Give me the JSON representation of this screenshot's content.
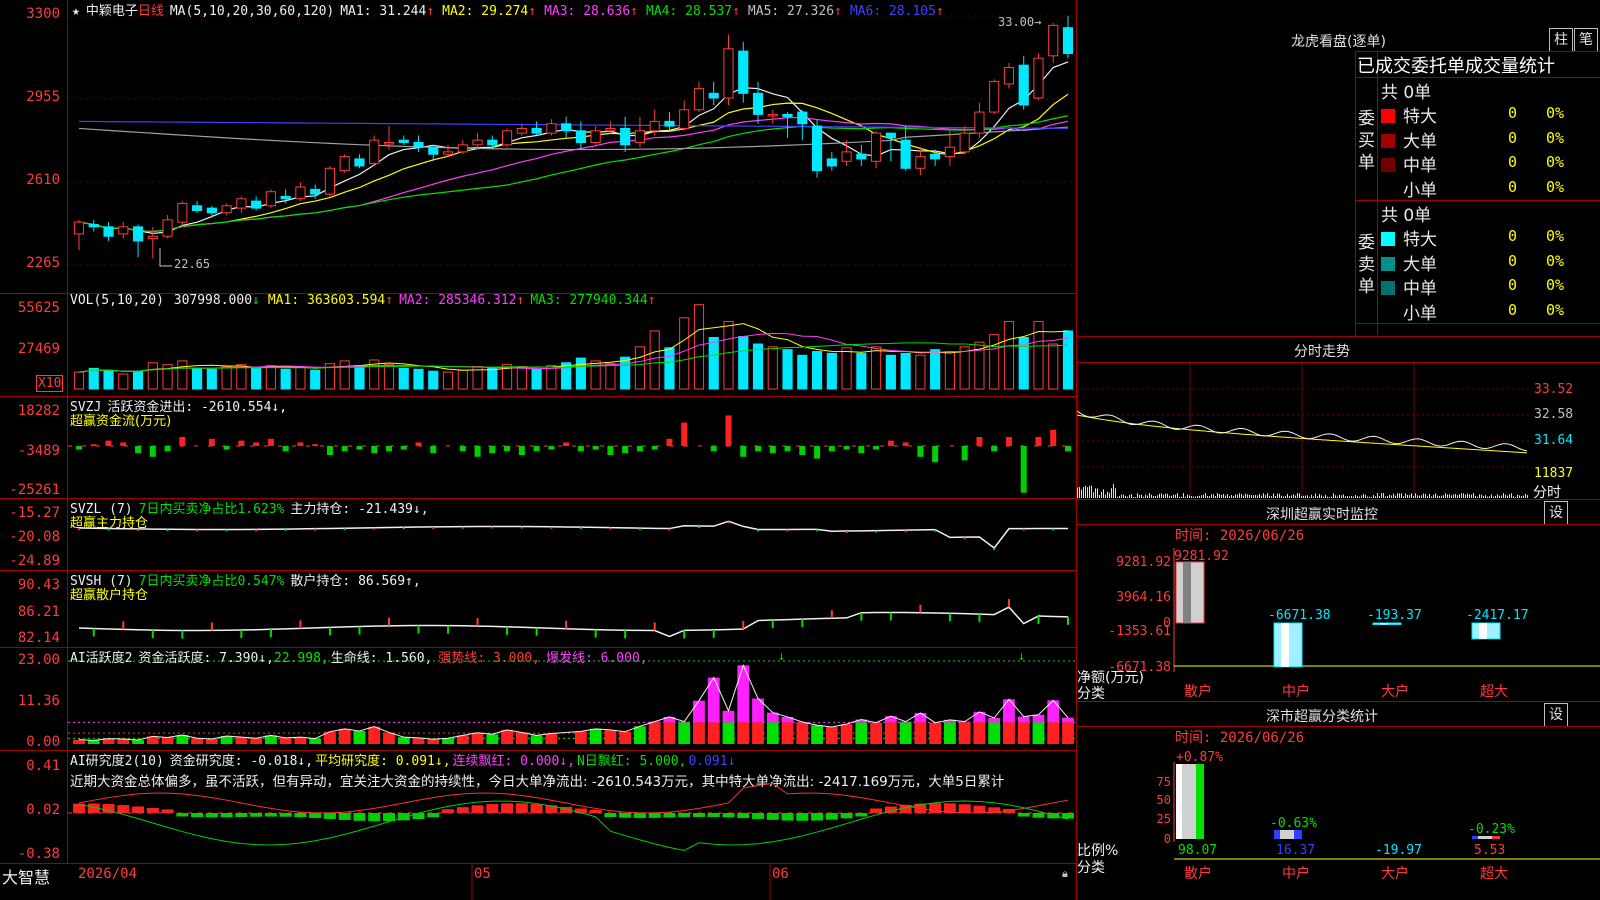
{
  "stock": {
    "star": "★",
    "name": "中颖电子",
    "period": "日线"
  },
  "ma_legend": {
    "label": "MA(5,10,20,30,60,120)",
    "items": [
      {
        "name": "MA1",
        "value": "31.244",
        "arrow": "↑",
        "color": "#f0f0f0"
      },
      {
        "name": "MA2",
        "value": "29.274",
        "arrow": "↑",
        "color": "#ffff00"
      },
      {
        "name": "MA3",
        "value": "28.636",
        "arrow": "↑",
        "color": "#ff3cff"
      },
      {
        "name": "MA4",
        "value": "28.537",
        "arrow": "↑",
        "color": "#00e000"
      },
      {
        "name": "MA5",
        "value": "27.326",
        "arrow": "↑",
        "color": "#c0c0c0"
      },
      {
        "name": "MA6",
        "value": "28.105",
        "arrow": "↑",
        "color": "#4040ff"
      }
    ]
  },
  "price_axis": [
    "3300",
    "2955",
    "2610",
    "2265"
  ],
  "price_marks": {
    "high": "33.00",
    "low": "22.65"
  },
  "vol_legend": {
    "label": "VOL(5,10,20)",
    "value": "307998.000",
    "arrow": "↓",
    "items": [
      {
        "name": "MA1",
        "value": "363603.594",
        "arrow": "↑",
        "color": "#ffff00"
      },
      {
        "name": "MA2",
        "value": "285346.312",
        "arrow": "↑",
        "color": "#ff3cff"
      },
      {
        "name": "MA3",
        "value": "277940.344",
        "arrow": "↑",
        "color": "#00e000"
      }
    ]
  },
  "vol_axis": [
    "55625",
    "27469",
    "X10"
  ],
  "svzj": {
    "name": "SVZJ",
    "line": "活跃资金进出: -2610.554↓,",
    "sub": "超赢资金流(万元)",
    "axis": [
      "18282",
      "-3489",
      "-25261"
    ]
  },
  "svzl": {
    "name": "SVZL (7)",
    "a": "7日内买卖净占比1.623%",
    "b": "主力持仓: -21.439↓,",
    "sub": "超赢主力持仓",
    "axis": [
      "-15.27",
      "-20.08",
      "-24.89"
    ]
  },
  "svsh": {
    "name": "SVSH (7)",
    "a": "7日内买卖净占比0.547%",
    "b": "散户持仓: 86.569↑,",
    "sub": "超赢散户持仓",
    "axis": [
      "90.43",
      "86.21",
      "82.14"
    ]
  },
  "ai2": {
    "name": "AI活跃度2",
    "a": "资金活跃度: 7.390↓,",
    "b": "22.998,",
    "c": "生命线: 1.560,",
    "d": "强势线: 3.000,",
    "e": "爆发线: 6.000,",
    "axis": [
      "23.00",
      "11.36",
      "0.00"
    ]
  },
  "ai_res": {
    "name": "AI研究度2(10)",
    "a": "资金研究度: -0.018↓,",
    "b": "平均研究度: 0.091↓,",
    "c": "连续飘红: 0.000↓,",
    "d": "N日飘红: 5.000,",
    "e": "0.091↓",
    "text": "近期大资金总体偏多，虽不活跃，但有异动，宜关注大资金的持续性，今日大单净流出: -2610.543万元，其中特大单净流出: -2417.169万元，大单5日累计",
    "axis": [
      "0.41",
      "0.02",
      "-0.38"
    ]
  },
  "footer": {
    "brand": "大智慧",
    "dates": [
      "2026/04",
      "05",
      "06"
    ]
  },
  "right": {
    "dragon": {
      "title": "龙虎看盘(逐单)",
      "btn1": "柱",
      "btn2": "笔",
      "subtitle": "已成交委托单成交量统计",
      "buy": {
        "label": "委买单",
        "total": "共 0单",
        "rows": [
          {
            "name": "特大",
            "value": "0",
            "pct": "0%",
            "color": "#ff0000"
          },
          {
            "name": "大单",
            "value": "0",
            "pct": "0%",
            "color": "#a00000"
          },
          {
            "name": "中单",
            "value": "0",
            "pct": "0%",
            "color": "#700000"
          },
          {
            "name": "小单",
            "value": "0",
            "pct": "0%",
            "color": "#000000"
          }
        ]
      },
      "sell": {
        "label": "委卖单",
        "total": "共 0单",
        "rows": [
          {
            "name": "特大",
            "value": "0",
            "pct": "0%",
            "color": "#00ffff"
          },
          {
            "name": "大单",
            "value": "0",
            "pct": "0%",
            "color": "#009090"
          },
          {
            "name": "中单",
            "value": "0",
            "pct": "0%",
            "color": "#007070"
          },
          {
            "name": "小单",
            "value": "0",
            "pct": "0%",
            "color": "#000000"
          }
        ]
      }
    },
    "intraday": {
      "title": "分时走势",
      "axis": [
        "33.52",
        "32.58",
        "31.64",
        "11837"
      ],
      "unit": "分时"
    },
    "monitor": {
      "title": "深圳超赢实时监控",
      "btn": "设",
      "time": "时间: 2026/06/26",
      "axis": [
        "9281.92",
        "3964.16",
        "0",
        "-1353.61",
        "-6671.38"
      ],
      "ylabel": "净额(万元)",
      "xlabel": "分类",
      "bars": [
        {
          "name": "散户",
          "value": "9281.92"
        },
        {
          "name": "中户",
          "value": "-6671.38"
        },
        {
          "name": "大户",
          "value": "-193.37"
        },
        {
          "name": "超大",
          "value": "-2417.17"
        }
      ]
    },
    "classify": {
      "title": "深市超赢分类统计",
      "btn": "设",
      "time": "时间: 2026/06/26",
      "axis": [
        "75",
        "50",
        "25",
        "0"
      ],
      "ylabel": "比例%",
      "xlabel": "分类",
      "bars": [
        {
          "name": "散户",
          "top": "+0.87%",
          "bottom": "98.07"
        },
        {
          "name": "中户",
          "top": "-0.63%",
          "bottom": "16.37"
        },
        {
          "name": "大户",
          "top": "",
          "bottom": "-19.97"
        },
        {
          "name": "超大",
          "top": "-0.23%",
          "bottom": "5.53"
        }
      ]
    }
  },
  "chart_data": {
    "type": "candlestick",
    "candles": [
      [
        23.7,
        24.2,
        23.0,
        24.3
      ],
      [
        24.1,
        24.0,
        23.8,
        24.3
      ],
      [
        24.0,
        23.6,
        23.4,
        24.2
      ],
      [
        23.7,
        24.0,
        23.5,
        24.2
      ],
      [
        24.0,
        23.4,
        22.7,
        24.1
      ],
      [
        23.5,
        23.6,
        22.65,
        24.0
      ],
      [
        23.6,
        24.3,
        23.5,
        24.5
      ],
      [
        24.2,
        25.0,
        24.0,
        25.1
      ],
      [
        24.9,
        24.7,
        24.6,
        25.1
      ],
      [
        24.8,
        24.6,
        24.4,
        24.9
      ],
      [
        24.6,
        24.9,
        24.5,
        25.0
      ],
      [
        24.8,
        25.2,
        24.6,
        25.3
      ],
      [
        25.1,
        24.8,
        24.7,
        25.3
      ],
      [
        24.9,
        25.5,
        24.8,
        25.6
      ],
      [
        25.3,
        25.2,
        25.0,
        25.6
      ],
      [
        25.2,
        25.7,
        25.1,
        25.9
      ],
      [
        25.6,
        25.4,
        25.2,
        25.8
      ],
      [
        25.4,
        26.5,
        25.3,
        26.6
      ],
      [
        26.4,
        27.0,
        26.3,
        27.1
      ],
      [
        26.9,
        26.6,
        26.5,
        27.1
      ],
      [
        26.7,
        27.7,
        26.6,
        27.9
      ],
      [
        27.6,
        27.6,
        27.3,
        28.3
      ],
      [
        27.7,
        27.6,
        27.5,
        27.9
      ],
      [
        27.6,
        27.4,
        27.2,
        27.9
      ],
      [
        27.4,
        27.1,
        26.8,
        27.5
      ],
      [
        27.1,
        27.2,
        27.0,
        27.5
      ],
      [
        27.2,
        27.5,
        27.1,
        27.7
      ],
      [
        27.5,
        27.7,
        27.3,
        28.0
      ],
      [
        27.7,
        27.5,
        27.3,
        27.9
      ],
      [
        27.5,
        28.1,
        27.4,
        28.2
      ],
      [
        28.0,
        28.2,
        27.9,
        28.4
      ],
      [
        28.2,
        28.0,
        27.9,
        28.5
      ],
      [
        28.0,
        28.4,
        27.9,
        28.6
      ],
      [
        28.4,
        28.1,
        27.8,
        28.7
      ],
      [
        28.1,
        27.6,
        27.3,
        28.5
      ],
      [
        27.6,
        28.1,
        27.5,
        28.3
      ],
      [
        28.1,
        28.2,
        28.0,
        28.5
      ],
      [
        28.2,
        27.5,
        27.2,
        28.7
      ],
      [
        27.6,
        28.1,
        27.4,
        28.7
      ],
      [
        28.1,
        28.5,
        27.9,
        29.0
      ],
      [
        28.5,
        28.3,
        28.1,
        28.9
      ],
      [
        28.2,
        29.0,
        28.1,
        29.4
      ],
      [
        29.0,
        29.9,
        28.9,
        30.2
      ],
      [
        29.7,
        29.5,
        29.2,
        30.2
      ],
      [
        29.5,
        31.6,
        29.2,
        32.2
      ],
      [
        31.5,
        29.7,
        29.3,
        31.9
      ],
      [
        29.7,
        28.8,
        28.4,
        30.2
      ],
      [
        28.8,
        28.8,
        28.4,
        29.0
      ],
      [
        28.8,
        28.7,
        27.8,
        28.9
      ],
      [
        28.9,
        28.4,
        27.7,
        29.0
      ],
      [
        28.3,
        26.4,
        26.1,
        28.6
      ],
      [
        26.9,
        26.6,
        26.4,
        27.2
      ],
      [
        26.8,
        27.2,
        26.6,
        27.7
      ],
      [
        27.1,
        26.9,
        26.6,
        27.5
      ],
      [
        26.8,
        28.0,
        26.5,
        28.1
      ],
      [
        28.0,
        27.8,
        26.8,
        28.0
      ],
      [
        27.7,
        26.5,
        26.4,
        28.3
      ],
      [
        26.5,
        27.0,
        26.2,
        27.4
      ],
      [
        27.1,
        26.9,
        26.6,
        27.3
      ],
      [
        27.0,
        27.4,
        26.6,
        28.1
      ],
      [
        27.2,
        28.0,
        27.1,
        28.3
      ],
      [
        28.0,
        28.9,
        27.8,
        29.3
      ],
      [
        28.9,
        30.2,
        28.8,
        30.3
      ],
      [
        30.1,
        30.8,
        29.9,
        31.0
      ],
      [
        30.9,
        29.2,
        29.0,
        31.3
      ],
      [
        29.5,
        31.2,
        29.4,
        31.4
      ],
      [
        31.3,
        32.6,
        31.0,
        32.7
      ],
      [
        32.5,
        31.4,
        31.2,
        33.0
      ]
    ],
    "up_color": "#ff3b3b",
    "down_color": "#00e8ff",
    "volume": [
      18,
      22,
      20,
      16,
      19,
      28,
      26,
      30,
      22,
      21,
      24,
      26,
      22,
      25,
      21,
      23,
      20,
      27,
      30,
      25,
      31,
      26,
      22,
      21,
      19,
      18,
      20,
      24,
      22,
      26,
      24,
      21,
      25,
      28,
      33,
      30,
      27,
      34,
      45,
      62,
      44,
      76,
      90,
      55,
      72,
      56,
      48,
      45,
      42,
      36,
      40,
      38,
      44,
      38,
      45,
      36,
      38,
      36,
      42,
      40,
      45,
      50,
      58,
      72,
      55,
      72,
      48,
      62
    ],
    "svzj": [
      -0.2,
      0.1,
      0.3,
      0.2,
      -0.4,
      -0.6,
      -0.3,
      0.5,
      0.4,
      -0.2,
      0.3,
      0.2,
      0.4,
      -0.3,
      0.2,
      0.1,
      -0.5,
      -0.3,
      -0.2,
      -0.4,
      -0.3,
      -0.2,
      0.2,
      -0.4,
      -0.3,
      -0.6,
      -0.4,
      -0.3,
      -0.5,
      -0.3,
      -0.2,
      0.2,
      -0.3,
      -0.2,
      -0.5,
      -0.4,
      -0.3,
      -0.2,
      0.4,
      1.3,
      -0.3,
      1.7,
      -0.6,
      -0.3,
      -0.4,
      -0.3,
      -0.5,
      -0.7,
      -0.3,
      -0.2,
      -0.4,
      -0.2,
      0.3,
      0.2,
      -0.6,
      -0.9,
      -0.8,
      0.5,
      -0.3,
      0.5,
      -2.6,
      0.5,
      0.9,
      -0.3
    ],
    "ai2": [
      1.2,
      1.0,
      1.5,
      1.4,
      1.1,
      2.1,
      1.8,
      2.5,
      1.6,
      1.4,
      2.2,
      1.9,
      1.6,
      2.4,
      1.7,
      1.9,
      1.5,
      3.4,
      4.2,
      3.6,
      4.8,
      3.2,
      1.9,
      1.7,
      1.3,
      1.6,
      2.4,
      3.1,
      2.7,
      3.9,
      3.2,
      2.4,
      2.9,
      3.5,
      4.2,
      3.9,
      3.4,
      4.9,
      6.2,
      7.5,
      6.2,
      12.0,
      18.4,
      9.2,
      21.8,
      12.6,
      8.7,
      7.5,
      6.1,
      5.2,
      4.7,
      5.5,
      6.8,
      5.9,
      7.7,
      6.2,
      8.6,
      5.9,
      6.7,
      6.2,
      8.9,
      7.2,
      12.4,
      7.6,
      8.1,
      12.1,
      7.3
    ]
  }
}
